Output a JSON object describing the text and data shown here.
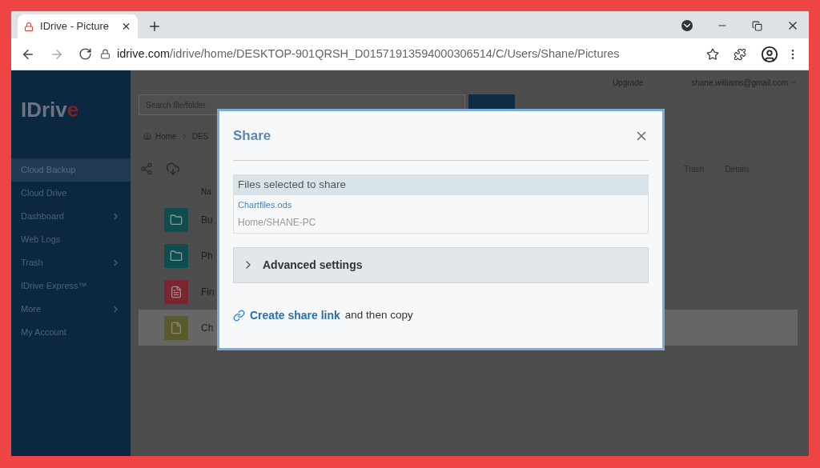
{
  "browser": {
    "tab": {
      "title": "IDrive - Picture"
    },
    "url": {
      "host": "idrive.com",
      "path": "/idrive/home/DESKTOP-901QRSH_D01571913594000306514/C/Users/Shane/Pictures"
    }
  },
  "sidebar": {
    "logo": "IDriv",
    "logo_mark": "e",
    "items": [
      {
        "label": "Cloud Backup",
        "selected": true,
        "has_submenu": false
      },
      {
        "label": "Cloud Drive",
        "selected": false,
        "has_submenu": false
      },
      {
        "label": "Dashboard",
        "selected": false,
        "has_submenu": true
      },
      {
        "label": "Web Logs",
        "selected": false,
        "has_submenu": false
      },
      {
        "label": "Trash",
        "selected": false,
        "has_submenu": true
      },
      {
        "label": "IDrive Express™",
        "selected": false,
        "has_submenu": false
      },
      {
        "label": "More",
        "selected": false,
        "has_submenu": true
      },
      {
        "label": "My Account",
        "selected": false,
        "has_submenu": false
      }
    ]
  },
  "header": {
    "upgrade": "Upgrade",
    "account": "shane.williams@gmail.com"
  },
  "search": {
    "placeholder": "Search file/folder"
  },
  "breadcrumb": [
    "Home",
    "DES"
  ],
  "toolbar": [
    "Trash",
    "Details"
  ],
  "files": {
    "column": "Na",
    "rows": [
      {
        "name": "Bu",
        "kind": "folder",
        "selected": false
      },
      {
        "name": "Ph",
        "kind": "folder",
        "selected": false
      },
      {
        "name": "Fin",
        "kind": "document",
        "selected": false
      },
      {
        "name": "Ch",
        "kind": "sheet",
        "selected": true
      }
    ]
  },
  "dialog": {
    "title": "Share",
    "files_header": "Files selected to share",
    "file_name": "Chartfiles.ods",
    "file_path": "Home/SHANE-PC",
    "advanced": {
      "label": "Advanced settings",
      "expanded": false
    },
    "link_action": "Create share link",
    "link_suffix": "and then copy"
  }
}
